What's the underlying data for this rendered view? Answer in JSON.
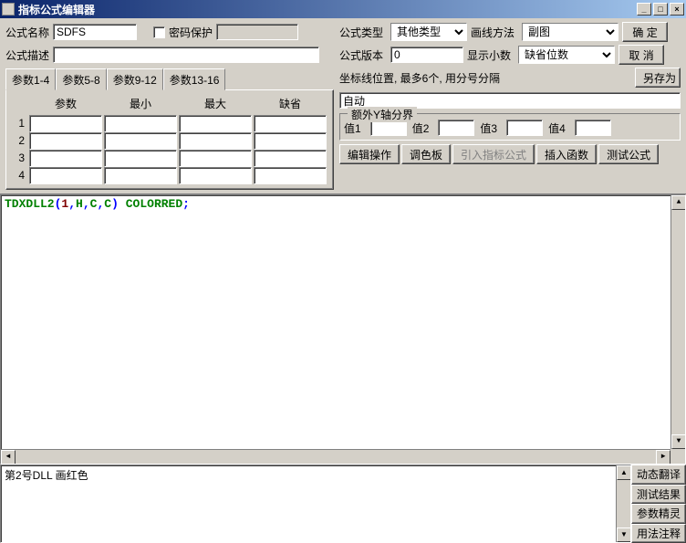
{
  "title": "指标公式编辑器",
  "winbtns": {
    "min": "_",
    "max": "□",
    "close": "×"
  },
  "labels": {
    "name": "公式名称",
    "passwordProtect": "密码保护",
    "type": "公式类型",
    "drawMethod": "画线方法",
    "desc": "公式描述",
    "version": "公式版本",
    "decimals": "显示小数",
    "coordLine": "坐标线位置, 最多6个, 用分号分隔",
    "extraY": "额外Y轴分界",
    "val1": "值1",
    "val2": "值2",
    "val3": "值3",
    "val4": "值4"
  },
  "fields": {
    "name": "SDFS",
    "password": "",
    "type": "其他类型",
    "drawMethod": "副图",
    "desc": "",
    "version": "0",
    "decimals": "缺省位数",
    "coordLine": "自动",
    "y1": "",
    "y2": "",
    "y3": "",
    "y4": ""
  },
  "buttons": {
    "ok": "确  定",
    "cancel": "取  消",
    "saveAs": "另存为",
    "editOp": "编辑操作",
    "palette": "调色板",
    "importFormula": "引入指标公式",
    "insertFunc": "插入函数",
    "testFormula": "测试公式",
    "dynTranslate": "动态翻译",
    "testResult": "测试结果",
    "paramWizard": "参数精灵",
    "usageNote": "用法注释"
  },
  "tabs": [
    "参数1-4",
    "参数5-8",
    "参数9-12",
    "参数13-16"
  ],
  "paramHeaders": [
    "参数",
    "最小",
    "最大",
    "缺省"
  ],
  "paramRows": 4,
  "code": {
    "p1": "TDXDLL2",
    "paren1": "(",
    "n1": "1",
    "c1": ",",
    "a1": "H",
    "c2": ",",
    "a2": "C",
    "c3": ",",
    "a3": "C",
    "paren2": ")",
    "sp": " ",
    "kw": "COLORRED",
    "semi": ";"
  },
  "status": "第2号DLL 画红色"
}
